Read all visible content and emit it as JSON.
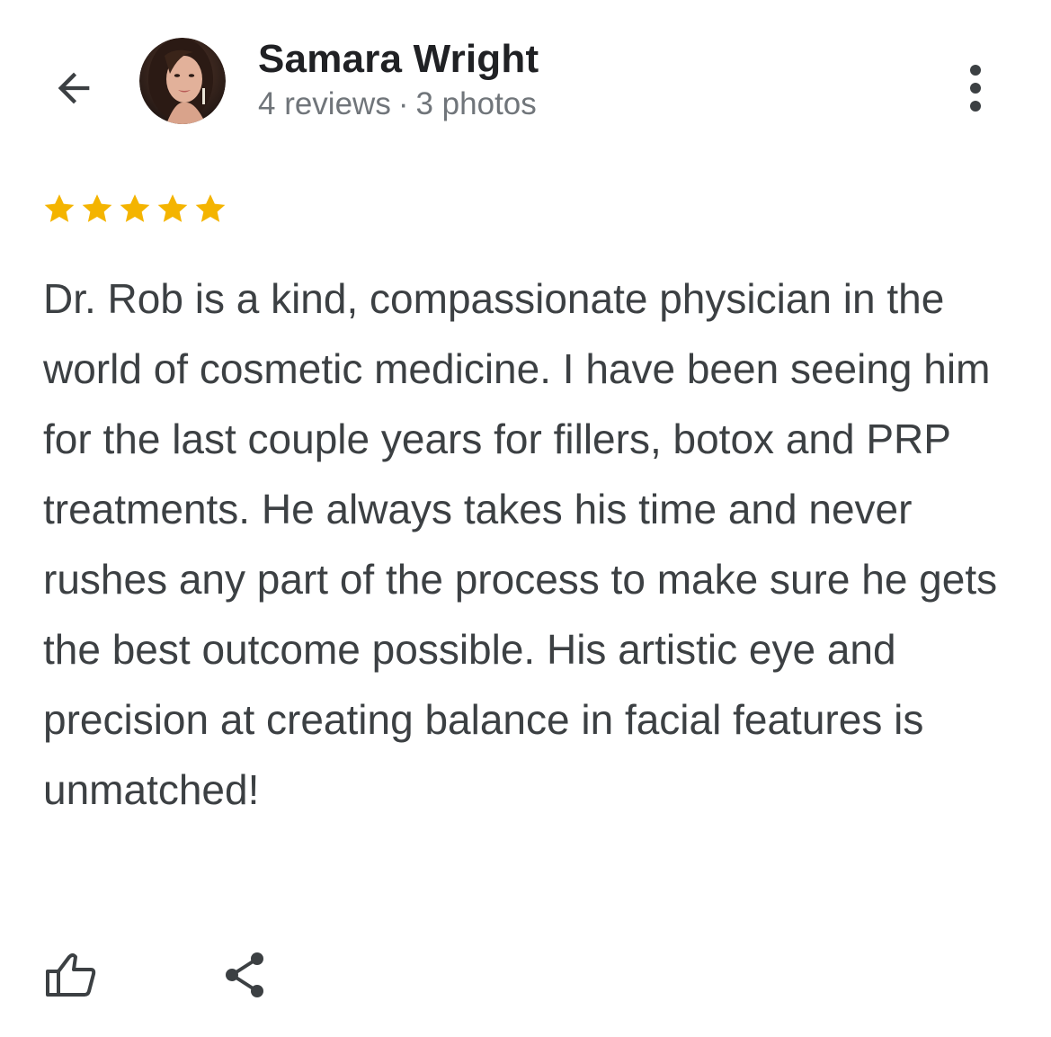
{
  "header": {
    "reviewer_name": "Samara Wright",
    "review_count": "4 reviews",
    "separator": "·",
    "photo_count": "3 photos"
  },
  "rating": {
    "stars": 5,
    "max_stars": 5,
    "star_color": "#f4b400"
  },
  "review": {
    "text": "Dr. Rob is a kind, compassionate physician in the world of cosmetic medicine. I have been seeing him for the last couple years for fillers, botox and PRP treatments. He always takes his time and never rushes any part of the process to make sure he gets the best outcome possible. His artistic eye and precision at creating balance in facial features is unmatched!"
  },
  "icons": {
    "back": "arrow-left-icon",
    "more": "more-vert-icon",
    "like": "thumbs-up-icon",
    "share": "share-icon"
  },
  "colors": {
    "title": "#202124",
    "body_text": "#3c4043",
    "meta_text": "#70757a",
    "icon": "#3c4043"
  }
}
